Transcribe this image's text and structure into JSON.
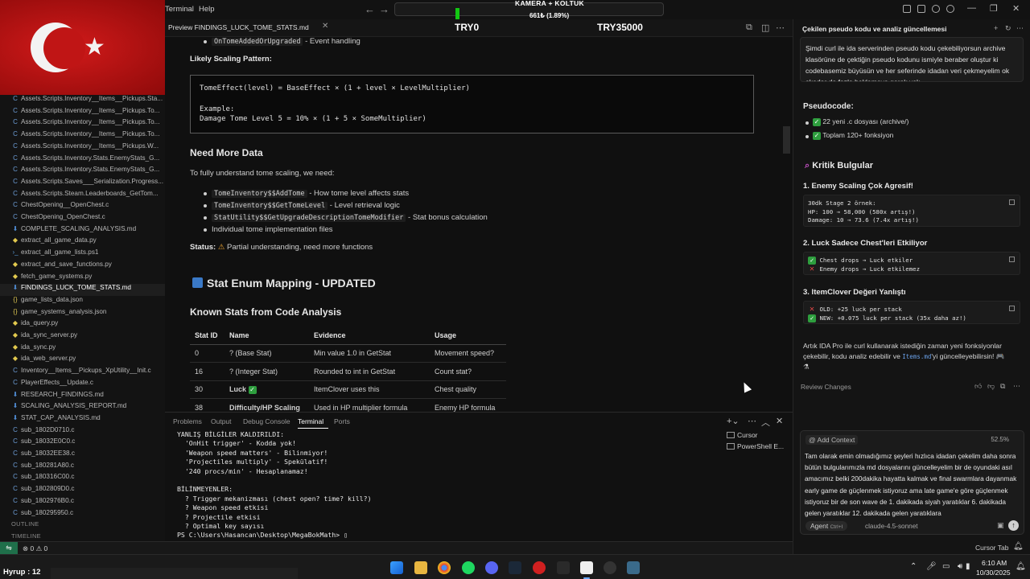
{
  "titlebar": {
    "menu_terminal": "Terminal",
    "menu_help": "Help",
    "overlay_title": "KAMERA + KOLTUK",
    "overlay_sub": "661₺ (1.89%)"
  },
  "editor_tab": {
    "label": "Preview FINDINGS_LUCK_TOME_STATS.md",
    "price_left": "TRY0",
    "price_right": "TRY35000"
  },
  "sidebar": {
    "files": [
      {
        "icon": "c",
        "name": "Assets.Scripts.Inventory__Items__Pickups.Sta..."
      },
      {
        "icon": "c",
        "name": "Assets.Scripts.Inventory__Items__Pickups.To..."
      },
      {
        "icon": "c",
        "name": "Assets.Scripts.Inventory__Items__Pickups.To..."
      },
      {
        "icon": "c",
        "name": "Assets.Scripts.Inventory__Items__Pickups.To..."
      },
      {
        "icon": "c",
        "name": "Assets.Scripts.Inventory__Items__Pickups.W..."
      },
      {
        "icon": "c",
        "name": "Assets.Scripts.Inventory.Stats.EnemyStats_G..."
      },
      {
        "icon": "c",
        "name": "Assets.Scripts.Inventory.Stats.EnemyStats_G..."
      },
      {
        "icon": "c",
        "name": "Assets.Scripts.Saves___Serialization.Progress..."
      },
      {
        "icon": "c",
        "name": "Assets.Scripts.Steam.Leaderboards_GetTom..."
      },
      {
        "icon": "c",
        "name": "ChestOpening__OpenChest.c"
      },
      {
        "icon": "c",
        "name": "ChestOpening_OpenChest.c"
      },
      {
        "icon": "md",
        "name": "COMPLETE_SCALING_ANALYSIS.md"
      },
      {
        "icon": "py",
        "name": "extract_all_game_data.py"
      },
      {
        "icon": "ps",
        "name": "extract_all_game_lists.ps1"
      },
      {
        "icon": "py",
        "name": "extract_and_save_functions.py"
      },
      {
        "icon": "py",
        "name": "fetch_game_systems.py"
      },
      {
        "icon": "md",
        "name": "FINDINGS_LUCK_TOME_STATS.md"
      },
      {
        "icon": "json",
        "name": "game_lists_data.json"
      },
      {
        "icon": "json",
        "name": "game_systems_analysis.json"
      },
      {
        "icon": "py",
        "name": "ida_query.py"
      },
      {
        "icon": "py",
        "name": "ida_sync_server.py"
      },
      {
        "icon": "py",
        "name": "ida_sync.py"
      },
      {
        "icon": "py",
        "name": "ida_web_server.py"
      },
      {
        "icon": "c",
        "name": "Inventory__Items__Pickups_XpUtility__Init.c"
      },
      {
        "icon": "c",
        "name": "PlayerEffects__Update.c"
      },
      {
        "icon": "md",
        "name": "RESEARCH_FINDINGS.md"
      },
      {
        "icon": "md",
        "name": "SCALING_ANALYSIS_REPORT.md"
      },
      {
        "icon": "md",
        "name": "STAT_CAP_ANALYSIS.md"
      },
      {
        "icon": "c",
        "name": "sub_1802D0710.c"
      },
      {
        "icon": "c",
        "name": "sub_18032E0C0.c"
      },
      {
        "icon": "c",
        "name": "sub_18032EE38.c"
      },
      {
        "icon": "c",
        "name": "sub_180281A80.c"
      },
      {
        "icon": "c",
        "name": "sub_180316C00.c"
      },
      {
        "icon": "c",
        "name": "sub_1802809D0.c"
      },
      {
        "icon": "c",
        "name": "sub_1802976B0.c"
      },
      {
        "icon": "c",
        "name": "sub_180295950.c"
      }
    ],
    "outline_label": "OUTLINE",
    "timeline_label": "TIMELINE"
  },
  "preview": {
    "top_code": "OnTomeAddedOrUpgraded",
    "top_text": " - Event handling",
    "scaling_heading": "Likely Scaling Pattern:",
    "codeblock": "TomeEffect(level) = BaseEffect × (1 + level × LevelMultiplier)\n\nExample:\nDamage Tome Level 5 = 10% × (1 + 5 × SomeMultiplier)",
    "need_more_heading": "Need More Data",
    "need_more_intro": "To fully understand tome scaling, we need:",
    "bullets": [
      {
        "code": "TomeInventory$$AddTome",
        "text": " - How tome level affects stats"
      },
      {
        "code": "TomeInventory$$GetTomeLevel",
        "text": " - Level retrieval logic"
      },
      {
        "code": "StatUtility$$GetUpgradeDescriptionTomeModifier",
        "text": " - Stat bonus calculation"
      },
      {
        "code": "",
        "text": "Individual tome implementation files"
      }
    ],
    "status_label": "Status:",
    "status_text": "Partial understanding, need more functions",
    "enum_heading": "Stat Enum Mapping - UPDATED",
    "known_heading": "Known Stats from Code Analysis",
    "table_headers": [
      "Stat ID",
      "Name",
      "Evidence",
      "Usage"
    ],
    "table_rows": [
      [
        "0",
        "? (Base Stat)",
        "Min value 1.0 in GetStat",
        "Movement speed?"
      ],
      [
        "16",
        "? (Integer Stat)",
        "Rounded to int in GetStat",
        "Count stat?"
      ],
      [
        "30",
        "Luck",
        "ItemClover uses this",
        "Chest quality"
      ],
      [
        "38",
        "Difficulty/HP Scaling",
        "Used in HP multiplier formula",
        "Enemy HP formula"
      ]
    ]
  },
  "panel": {
    "tabs": [
      "Problems",
      "Output",
      "Debug Console",
      "Terminal",
      "Ports"
    ],
    "terminal_lines": [
      "YANLIŞ BİLGİLER KALDIRILDI:",
      "  'OnHit trigger' - Kodda yok!",
      "  'Weapon speed matters' - Bilinmiyor!",
      "  'Projectiles multiply' - Spekülatif!",
      "  '240 procs/min' - Hesaplanamaz!",
      "",
      "BİLİNMEYENLER:",
      "  ? Trigger mekanizması (chest open? time? kill?)",
      "  ? Weapon speed etkisi",
      "  ? Projectile etkisi",
      "  ? Optimal key sayısı",
      "PS C:\\Users\\Hasancan\\Desktop\\MegaBokMath> "
    ],
    "terminals": [
      "Cursor",
      "PowerShell E..."
    ]
  },
  "statusbar": {
    "errors": "⊗ 0 ⚠ 0",
    "cursor_tab": "Cursor Tab"
  },
  "chat": {
    "title": "Çekilen pseudo kodu ve analiz güncellemesi",
    "user_message": "Şimdi curl ile ida serverinden pseudo kodu çekebiliyorsun archive klasörüne de çektiğin pseudo kodunu ismiyle beraber oluştur ki codebasemiz büyüsün ve her seferinde idadan veri çekmeyelim ok okadar da fazla beklemeye gerek yok",
    "pseudocode_heading": "Pseudocode:",
    "pseudo_items": [
      "22 yeni .c dosyası (archive/)",
      "Toplam 120+ fonksiyon"
    ],
    "critical_heading": "Kritik Bulgular",
    "h1": "1. Enemy Scaling Çok Agresif!",
    "code1": "30dk Stage 2 örnek:\nHP: 100 → 58,000 (580x artış!)\nDamage: 10 → 73.6 (7.4x artış!)",
    "h2": "2. Luck Sadece Chest'leri Etkiliyor",
    "code2_a": "Chest drops → Luck etkiler",
    "code2_b": "Enemy drops → Luck etkilemez",
    "h3": "3. ItemClover Değeri Yanlıştı",
    "code3_a": "OLD: +25 luck per stack",
    "code3_b": "NEW: +0.075 luck per stack (35x daha az!)",
    "final_text_1": "Artık IDA Pro ile curl kullanarak istediğin zaman yeni fonksiyonlar",
    "final_text_2": "çekebilir, kodu analiz edebilir ve",
    "final_code": "Items.md",
    "final_text_3": "'yi güncelleyebilirsin!",
    "review_changes": "Review Changes",
    "add_context": "@ Add Context",
    "context_pct": "52.5%",
    "composer_text": "Tam olarak emin olmadığımız şeyleri hızlıca idadan çekelim daha sonra bütün bulgularımızla md dosyalarını güncelleyelim bir de oyundaki asıl amacımız belki 200dakika hayatta kalmak ve final swarmlara dayanmak early game de güçlenmek istiyoruz ama late game'e göre güçlenmek istiyoruz bir de son wave de 1. dakikada siyah yaratıklar 6. dakikada gelen yaratıklar 12. dakikada gelen yaratıklara",
    "agent_label": "Agent",
    "agent_shortcut": "Ctrl+I",
    "model": "claude-4.5-sonnet"
  },
  "taskbar": {
    "hyrup": "Hyrup : 12",
    "time": "6:10 AM",
    "date": "10/30/2025"
  }
}
